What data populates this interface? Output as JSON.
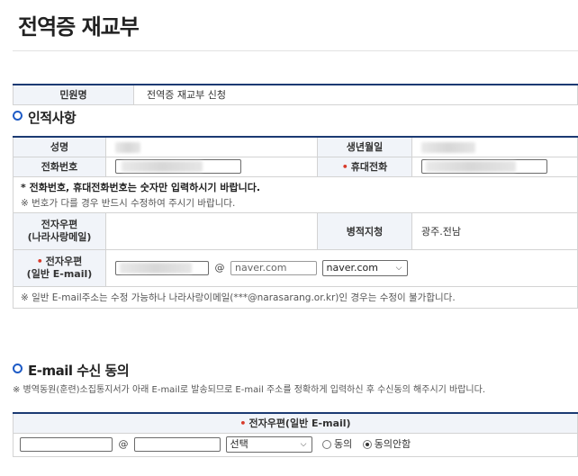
{
  "page": {
    "title": "전역증 재교부"
  },
  "civil": {
    "label": "민원명",
    "value": "전역증 재교부 신청"
  },
  "section1": {
    "title": "인적사항"
  },
  "personal": {
    "name_label": "성명",
    "birth_label": "생년월일",
    "phone_label": "전화번호",
    "mobile_label": "휴대전화",
    "notice_bold": "* 전화번호, 휴대전화번호는 숫자만 입력하시기 바랍니다.",
    "notice_sub": "※ 번호가 다를 경우 반드시 수정하여 주시기 바랍니다.",
    "email_nara_label_1": "전자우편",
    "email_nara_label_2": "(나라사랑메일)",
    "office_label": "병적지청",
    "office_value": "광주.전남",
    "email_general_label_1": "전자우편",
    "email_general_label_2": "(일반 E-mail)",
    "at": "@",
    "domain_input": "naver.com",
    "domain_select": "naver.com",
    "footer_note": "※ 일반 E-mail주소는 수정 가능하나 나라사랑이메일(***@narasarang.or.kr)인 경우는 수정이 불가합니다."
  },
  "section2": {
    "title": "E-mail 수신 동의",
    "desc": "※ 병역동원(훈련)소집통지서가 아래 E-mail로 발송되므로 E-mail 주소를 정확하게 입력하신 후 수신동의 해주시기 바랍니다."
  },
  "consent": {
    "header": "전자우편(일반 E-mail)",
    "at": "@",
    "select_value": "선택",
    "agree": "동의",
    "disagree": "동의안함",
    "selected": "disagree"
  }
}
